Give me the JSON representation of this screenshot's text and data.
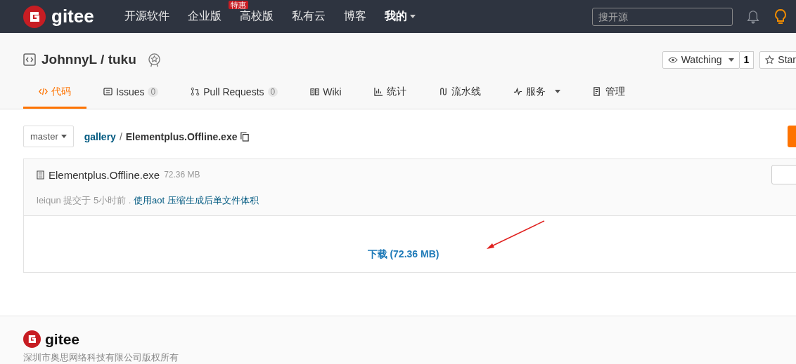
{
  "header": {
    "logo": "gitee",
    "nav": [
      {
        "label": "开源软件",
        "kind": "link"
      },
      {
        "label": "企业版",
        "kind": "link",
        "badge": "特惠"
      },
      {
        "label": "高校版",
        "kind": "link"
      },
      {
        "label": "私有云",
        "kind": "link"
      },
      {
        "label": "博客",
        "kind": "link"
      },
      {
        "label": "我的",
        "kind": "dropdown"
      }
    ],
    "search": {
      "placeholder": "搜开源"
    }
  },
  "repo": {
    "owner": "JohnnyL",
    "separator": "/",
    "name": "tuku",
    "watch": {
      "label": "Watching",
      "count": "1"
    },
    "star": {
      "label": "Star"
    }
  },
  "tabs": [
    {
      "label": "代码",
      "selected": true
    },
    {
      "label": "Issues",
      "count": "0",
      "selected": false
    },
    {
      "label": "Pull Requests",
      "count": "0",
      "selected": false
    },
    {
      "label": "Wiki",
      "selected": false
    },
    {
      "label": "统计",
      "selected": false
    },
    {
      "label": "流水线",
      "selected": false
    },
    {
      "label": "服务",
      "dropdown": true,
      "selected": false
    },
    {
      "label": "管理",
      "selected": false
    }
  ],
  "branch": "master",
  "path": {
    "folder": "gallery",
    "separator": "/",
    "file": "Elementplus.Offline.exe"
  },
  "file": {
    "name": "Elementplus.Offline.exe",
    "size": "72.36 MB",
    "author": "leiqun",
    "action": "提交于",
    "time": "5小时前",
    "dot": ".",
    "message": "使用aot 压缩生成后单文件体积",
    "download": "下载 (72.36 MB)"
  },
  "footer": {
    "logo": "gitee",
    "copyright": "深圳市奥思网络科技有限公司版权所有"
  }
}
